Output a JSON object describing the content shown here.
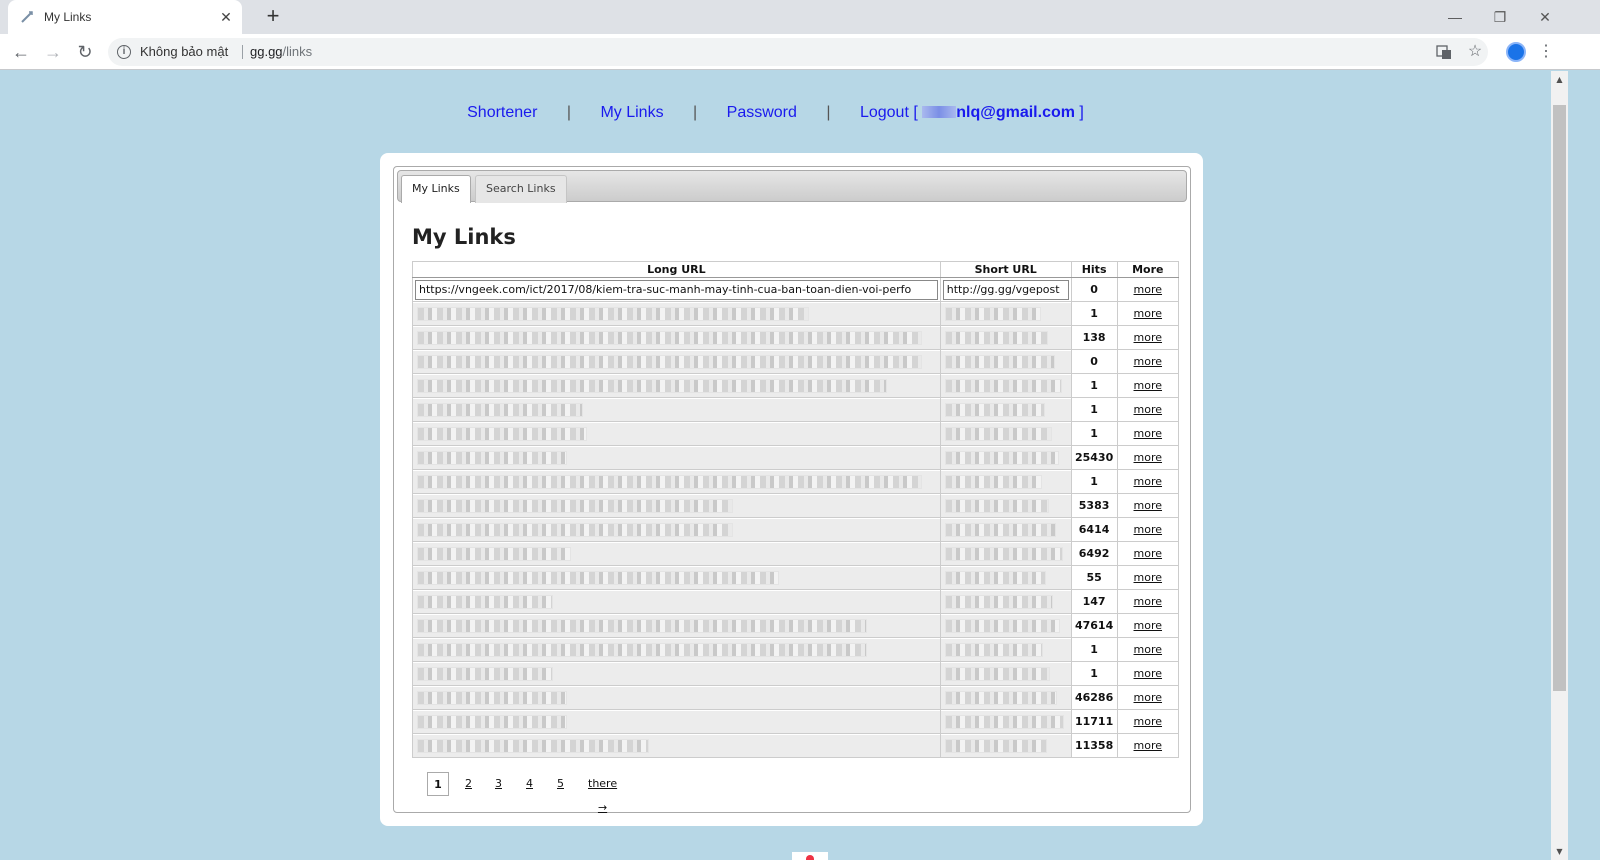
{
  "browser": {
    "tab_title": "My Links",
    "tab_close": "✕",
    "new_tab": "+",
    "not_secure_label": "Không bảo mật",
    "url_host": "gg.gg",
    "url_path": "/links",
    "window_controls": {
      "minimize": "—",
      "restore": "❐",
      "close": "✕"
    },
    "nav": {
      "back": "←",
      "forward": "→",
      "reload": "↻"
    },
    "icons": {
      "translate": "translate-icon",
      "star": "star-icon",
      "menu": "more-vert-icon"
    }
  },
  "topnav": {
    "shortener": "Shortener",
    "my_links": "My Links",
    "password": "Password",
    "logout_prefix": "Logout [",
    "email_visible": "nlq@gmail.com",
    "logout_suffix": "]",
    "separator": "|"
  },
  "tabs": [
    {
      "label": "My Links",
      "active": true
    },
    {
      "label": "Search Links",
      "active": false
    }
  ],
  "heading": "My Links",
  "table": {
    "headers": {
      "long": "Long URL",
      "short": "Short URL",
      "hits": "Hits",
      "more": "More"
    },
    "first_row": {
      "long_url": "https://vngeek.com/ict/2017/08/kiem-tra-suc-manh-may-tinh-cua-ban-toan-dien-voi-perfo",
      "short_url": "http://gg.gg/vgepost",
      "hits": "0",
      "more": "more"
    },
    "rows": [
      {
        "hits": "1",
        "more": "more"
      },
      {
        "hits": "138",
        "more": "more"
      },
      {
        "hits": "0",
        "more": "more"
      },
      {
        "hits": "1",
        "more": "more"
      },
      {
        "hits": "1",
        "more": "more"
      },
      {
        "hits": "1",
        "more": "more"
      },
      {
        "hits": "25430",
        "more": "more"
      },
      {
        "hits": "1",
        "more": "more"
      },
      {
        "hits": "5383",
        "more": "more"
      },
      {
        "hits": "6414",
        "more": "more"
      },
      {
        "hits": "6492",
        "more": "more"
      },
      {
        "hits": "55",
        "more": "more"
      },
      {
        "hits": "147",
        "more": "more"
      },
      {
        "hits": "47614",
        "more": "more"
      },
      {
        "hits": "1",
        "more": "more"
      },
      {
        "hits": "1",
        "more": "more"
      },
      {
        "hits": "46286",
        "more": "more"
      },
      {
        "hits": "11711",
        "more": "more"
      },
      {
        "hits": "11358",
        "more": "more"
      }
    ]
  },
  "pager": {
    "current": "1",
    "pages": [
      "2",
      "3",
      "4",
      "5"
    ],
    "next": "there →"
  }
}
